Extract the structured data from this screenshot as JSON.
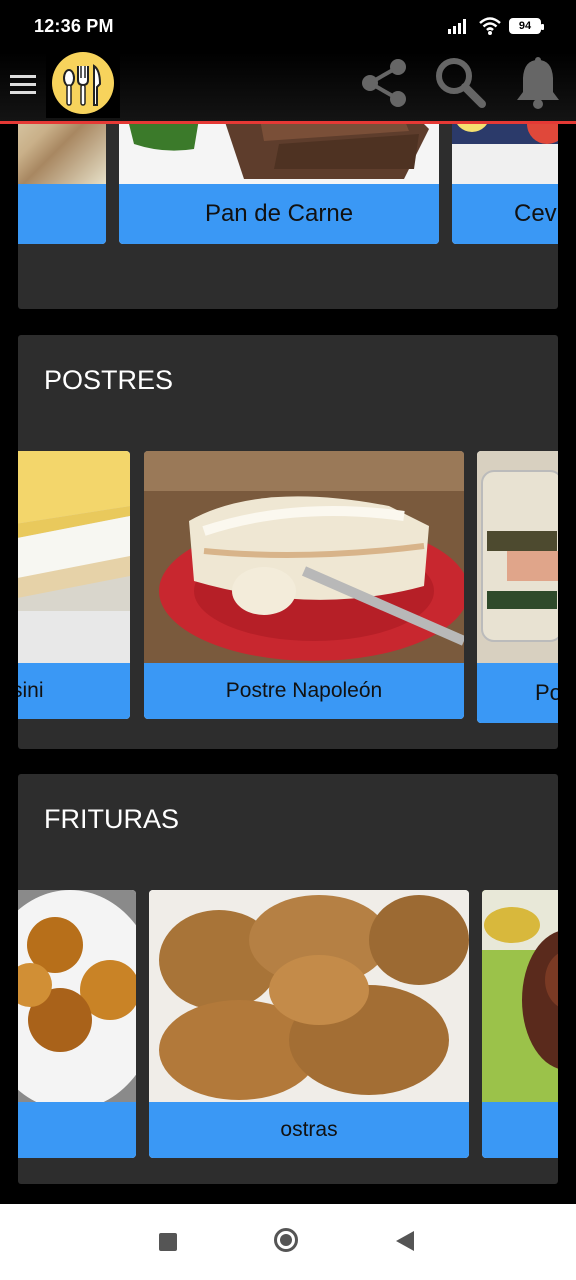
{
  "status_bar": {
    "time": "12:36 PM",
    "battery": "94"
  },
  "sections": {
    "top": {
      "cards": [
        "",
        "Pan de Carne",
        "Cev"
      ]
    },
    "postres": {
      "title": "POSTRES",
      "cards": [
        "sini",
        "Postre Napoleón",
        "Po"
      ]
    },
    "frituras": {
      "title": "FRITURAS",
      "cards": [
        "",
        "ostras",
        ""
      ]
    }
  },
  "colors": {
    "label_bg": "#3a98f5",
    "section_bg": "#2d2d2d",
    "accent_line": "#e53935",
    "logo_bg": "#f7d35c"
  },
  "icons": [
    "menu-icon",
    "app-logo",
    "share-icon",
    "search-icon",
    "bell-icon",
    "signal-icon",
    "wifi-icon",
    "battery-icon",
    "recents-icon",
    "home-icon",
    "back-icon"
  ]
}
